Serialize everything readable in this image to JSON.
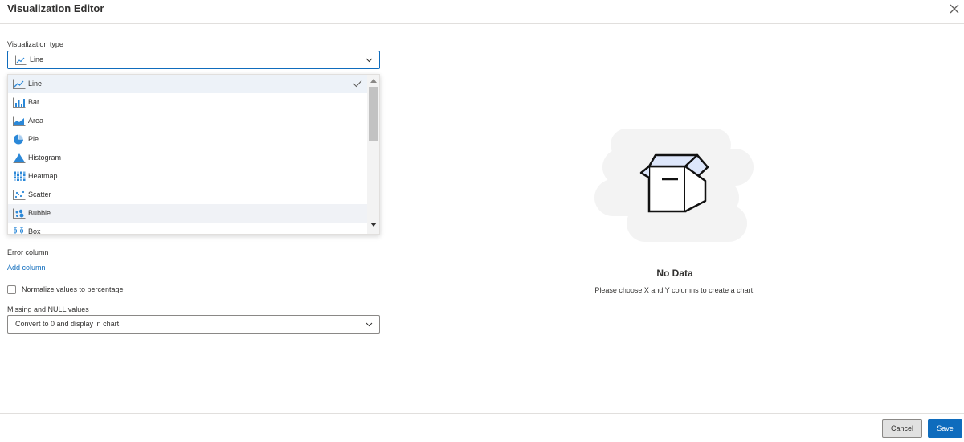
{
  "header": {
    "title": "Visualization Editor"
  },
  "viz_type": {
    "label": "Visualization type",
    "selected": "Line",
    "options": [
      {
        "label": "Line",
        "icon": "line-chart-icon"
      },
      {
        "label": "Bar",
        "icon": "bar-chart-icon"
      },
      {
        "label": "Area",
        "icon": "area-chart-icon"
      },
      {
        "label": "Pie",
        "icon": "pie-chart-icon"
      },
      {
        "label": "Histogram",
        "icon": "histogram-icon"
      },
      {
        "label": "Heatmap",
        "icon": "heatmap-icon"
      },
      {
        "label": "Scatter",
        "icon": "scatter-icon"
      },
      {
        "label": "Bubble",
        "icon": "bubble-icon"
      },
      {
        "label": "Box",
        "icon": "box-plot-icon"
      }
    ]
  },
  "error_column": {
    "label": "Error column",
    "link": "Add column"
  },
  "normalize": {
    "label": "Normalize values to percentage",
    "checked": false
  },
  "missing": {
    "label": "Missing and NULL values",
    "value": "Convert to 0 and display in chart"
  },
  "empty_state": {
    "title": "No Data",
    "subtitle": "Please choose X and Y columns to create a chart."
  },
  "footer": {
    "cancel": "Cancel",
    "save": "Save"
  },
  "colors": {
    "accent": "#0f6cbd",
    "selected_row": "#edf2f8",
    "icon_blue": "#2b88d8",
    "illustration_fill": "#dde6fa"
  }
}
